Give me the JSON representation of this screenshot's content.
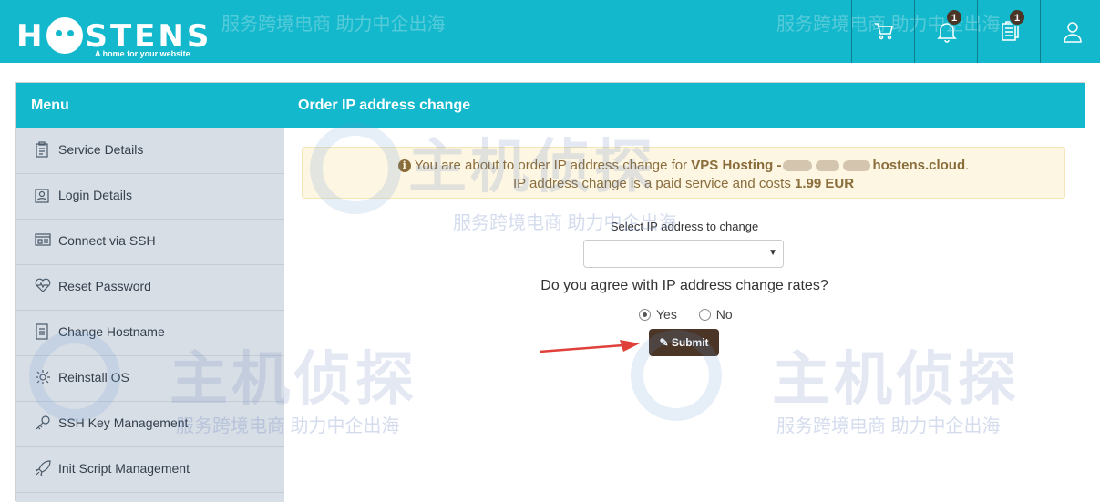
{
  "header": {
    "logo_text_left": "H",
    "logo_text_right": "STENS",
    "logo_tagline": "A home for your website",
    "watermark_text": "服务跨境电商 助力中企出海",
    "icons": [
      {
        "name": "cart-icon",
        "badge": ""
      },
      {
        "name": "bell-icon",
        "badge": "1"
      },
      {
        "name": "document-icon",
        "badge": "1"
      },
      {
        "name": "user-icon",
        "badge": ""
      }
    ]
  },
  "menu": {
    "title": "Menu",
    "items": [
      {
        "label": "Service Details",
        "icon": "clipboard-icon"
      },
      {
        "label": "Login Details",
        "icon": "id-card-icon"
      },
      {
        "label": "Connect via SSH",
        "icon": "terminal-icon"
      },
      {
        "label": "Reset Password",
        "icon": "heartbeat-icon"
      },
      {
        "label": "Change Hostname",
        "icon": "file-icon"
      },
      {
        "label": "Reinstall OS",
        "icon": "gear-icon"
      },
      {
        "label": "SSH Key Management",
        "icon": "key-icon"
      },
      {
        "label": "Init Script Management",
        "icon": "rocket-icon"
      }
    ]
  },
  "content": {
    "title": "Order IP address change",
    "alert": {
      "prefix": "You are about to order IP address change for",
      "service": "VPS Hosting -",
      "host": "hostens.cloud",
      "suffix": ".",
      "line2_prefix": "IP address change is a paid service and costs",
      "price": "1.99 EUR"
    },
    "select_label": "Select IP address to change",
    "select_value": "",
    "question": "Do you agree with IP address change rates?",
    "options": [
      "Yes",
      "No"
    ],
    "selected_option": "Yes",
    "submit_label": "Submit"
  },
  "watermark": {
    "brand": "主机侦探",
    "slogan": "服务跨境电商 助力中企出海"
  },
  "colors": {
    "header_bg": "#14b8cc",
    "sidebar_bg": "#d8dee6",
    "alert_bg": "#fcf6e3",
    "alert_text": "#8a6d3b",
    "button_bg": "#4a3526",
    "badge_bg": "#4a3526",
    "arrow": "#e0403a"
  }
}
